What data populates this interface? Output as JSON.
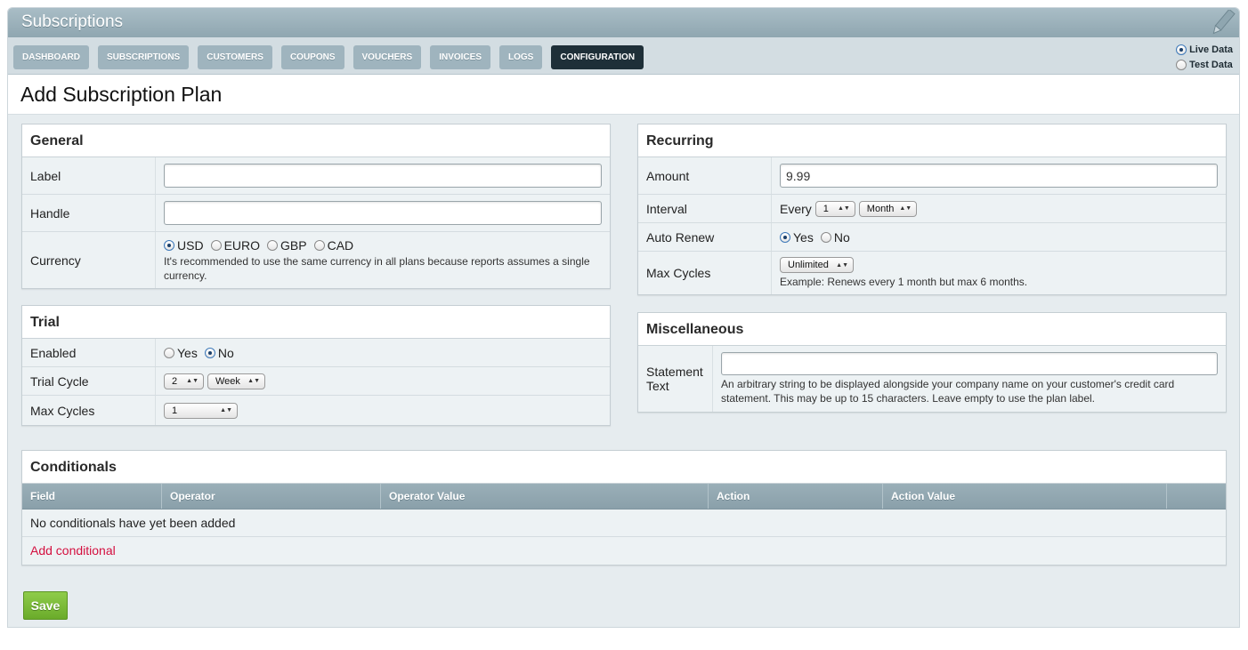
{
  "app": {
    "title": "Subscriptions"
  },
  "nav": {
    "tabs": [
      {
        "label": "DASHBOARD"
      },
      {
        "label": "SUBSCRIPTIONS"
      },
      {
        "label": "CUSTOMERS"
      },
      {
        "label": "COUPONS"
      },
      {
        "label": "VOUCHERS"
      },
      {
        "label": "INVOICES"
      },
      {
        "label": "LOGS"
      },
      {
        "label": "CONFIGURATION",
        "active": true
      }
    ],
    "data_mode": {
      "live": "Live Data",
      "test": "Test Data",
      "selected": "live"
    }
  },
  "page": {
    "title": "Add Subscription Plan"
  },
  "general": {
    "heading": "General",
    "label_label": "Label",
    "label_value": "",
    "handle_label": "Handle",
    "handle_value": "",
    "currency_label": "Currency",
    "currencies": [
      "USD",
      "EURO",
      "GBP",
      "CAD"
    ],
    "currency_selected": "USD",
    "currency_help": "It's recommended to use the same currency in all plans because reports assumes a single currency."
  },
  "trial": {
    "heading": "Trial",
    "enabled_label": "Enabled",
    "yes": "Yes",
    "no": "No",
    "enabled_selected": "No",
    "cycle_label": "Trial Cycle",
    "cycle_count": "2",
    "cycle_unit": "Week",
    "max_cycles_label": "Max Cycles",
    "max_cycles_value": "1"
  },
  "recurring": {
    "heading": "Recurring",
    "amount_label": "Amount",
    "amount_value": "9.99",
    "interval_label": "Interval",
    "interval_prefix": "Every",
    "interval_count": "1",
    "interval_unit": "Month",
    "auto_renew_label": "Auto Renew",
    "yes": "Yes",
    "no": "No",
    "auto_renew_selected": "Yes",
    "max_cycles_label": "Max Cycles",
    "max_cycles_value": "Unlimited",
    "max_cycles_help": "Example: Renews every 1 month but max 6 months."
  },
  "misc": {
    "heading": "Miscellaneous",
    "statement_label_line1": "Statement",
    "statement_label_line2": "Text",
    "statement_value": "",
    "statement_help": "An arbitrary string to be displayed alongside your company name on your customer's credit card statement. This may be up to 15 characters. Leave empty to use the plan label."
  },
  "conditionals": {
    "heading": "Conditionals",
    "columns": [
      "Field",
      "Operator",
      "Operator Value",
      "Action",
      "Action Value",
      ""
    ],
    "empty_text": "No conditionals have yet been added",
    "add_link": "Add conditional"
  },
  "actions": {
    "save_label": "Save"
  },
  "colors": {
    "accent_green": "#6aab2a",
    "link_red": "#d40f3f",
    "nav_active": "#1e2f38",
    "titlebar": "#9fb4be"
  }
}
